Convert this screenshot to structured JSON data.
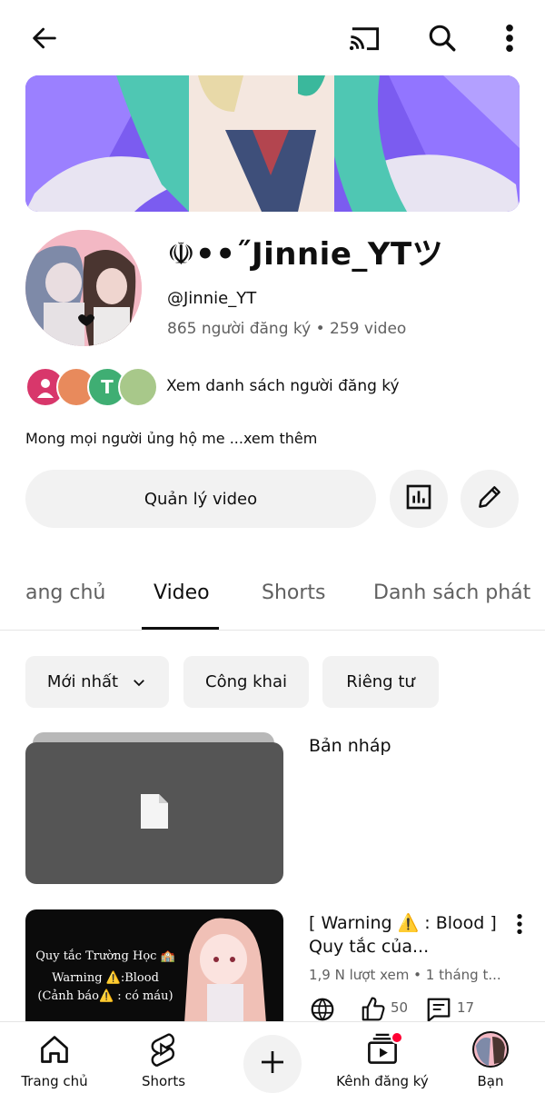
{
  "channel": {
    "name": "☫••˝Jinnie_YTツ",
    "handle": "@Jinnie_YT",
    "stats": "865 người đăng ký • 259 video",
    "subscribers_link": "Xem danh sách người đăng ký",
    "subscriber_avatar_letter": "T",
    "description": "Mong mọi người ủng hộ me ...xem thêm",
    "manage_button": "Quản lý video"
  },
  "tabs": [
    {
      "label": "ang chủ"
    },
    {
      "label": "Video"
    },
    {
      "label": "Shorts"
    },
    {
      "label": "Danh sách phát"
    }
  ],
  "active_tab": "Video",
  "filters": [
    {
      "label": "Mới nhất"
    },
    {
      "label": "Công khai"
    },
    {
      "label": "Riêng tư"
    }
  ],
  "videos": [
    {
      "title": "Bản nháp"
    },
    {
      "title": "[ Warning ⚠️ : Blood ] Quy tắc của...",
      "meta": "1,9 N lượt xem • 1 tháng t...",
      "likes": "50",
      "comments": "17",
      "thumb_line1": "Quy tắc Trường Học 🏫",
      "thumb_line2": "Warning ⚠️:Blood",
      "thumb_line3": "(Cảnh báo⚠️ : có máu)"
    }
  ],
  "bottom_nav": [
    {
      "label": "Trang chủ"
    },
    {
      "label": "Shorts"
    },
    {
      "label": "Kênh đăng ký"
    },
    {
      "label": "Bạn"
    }
  ],
  "colors": {
    "banner_purple": "#7b5cf0",
    "avatar_pink": "#f3b8c4",
    "notification_red": "#ff0033",
    "chip_bg": "#f2f2f2",
    "draft_gray": "#555555",
    "secondary_text": "#606060"
  }
}
